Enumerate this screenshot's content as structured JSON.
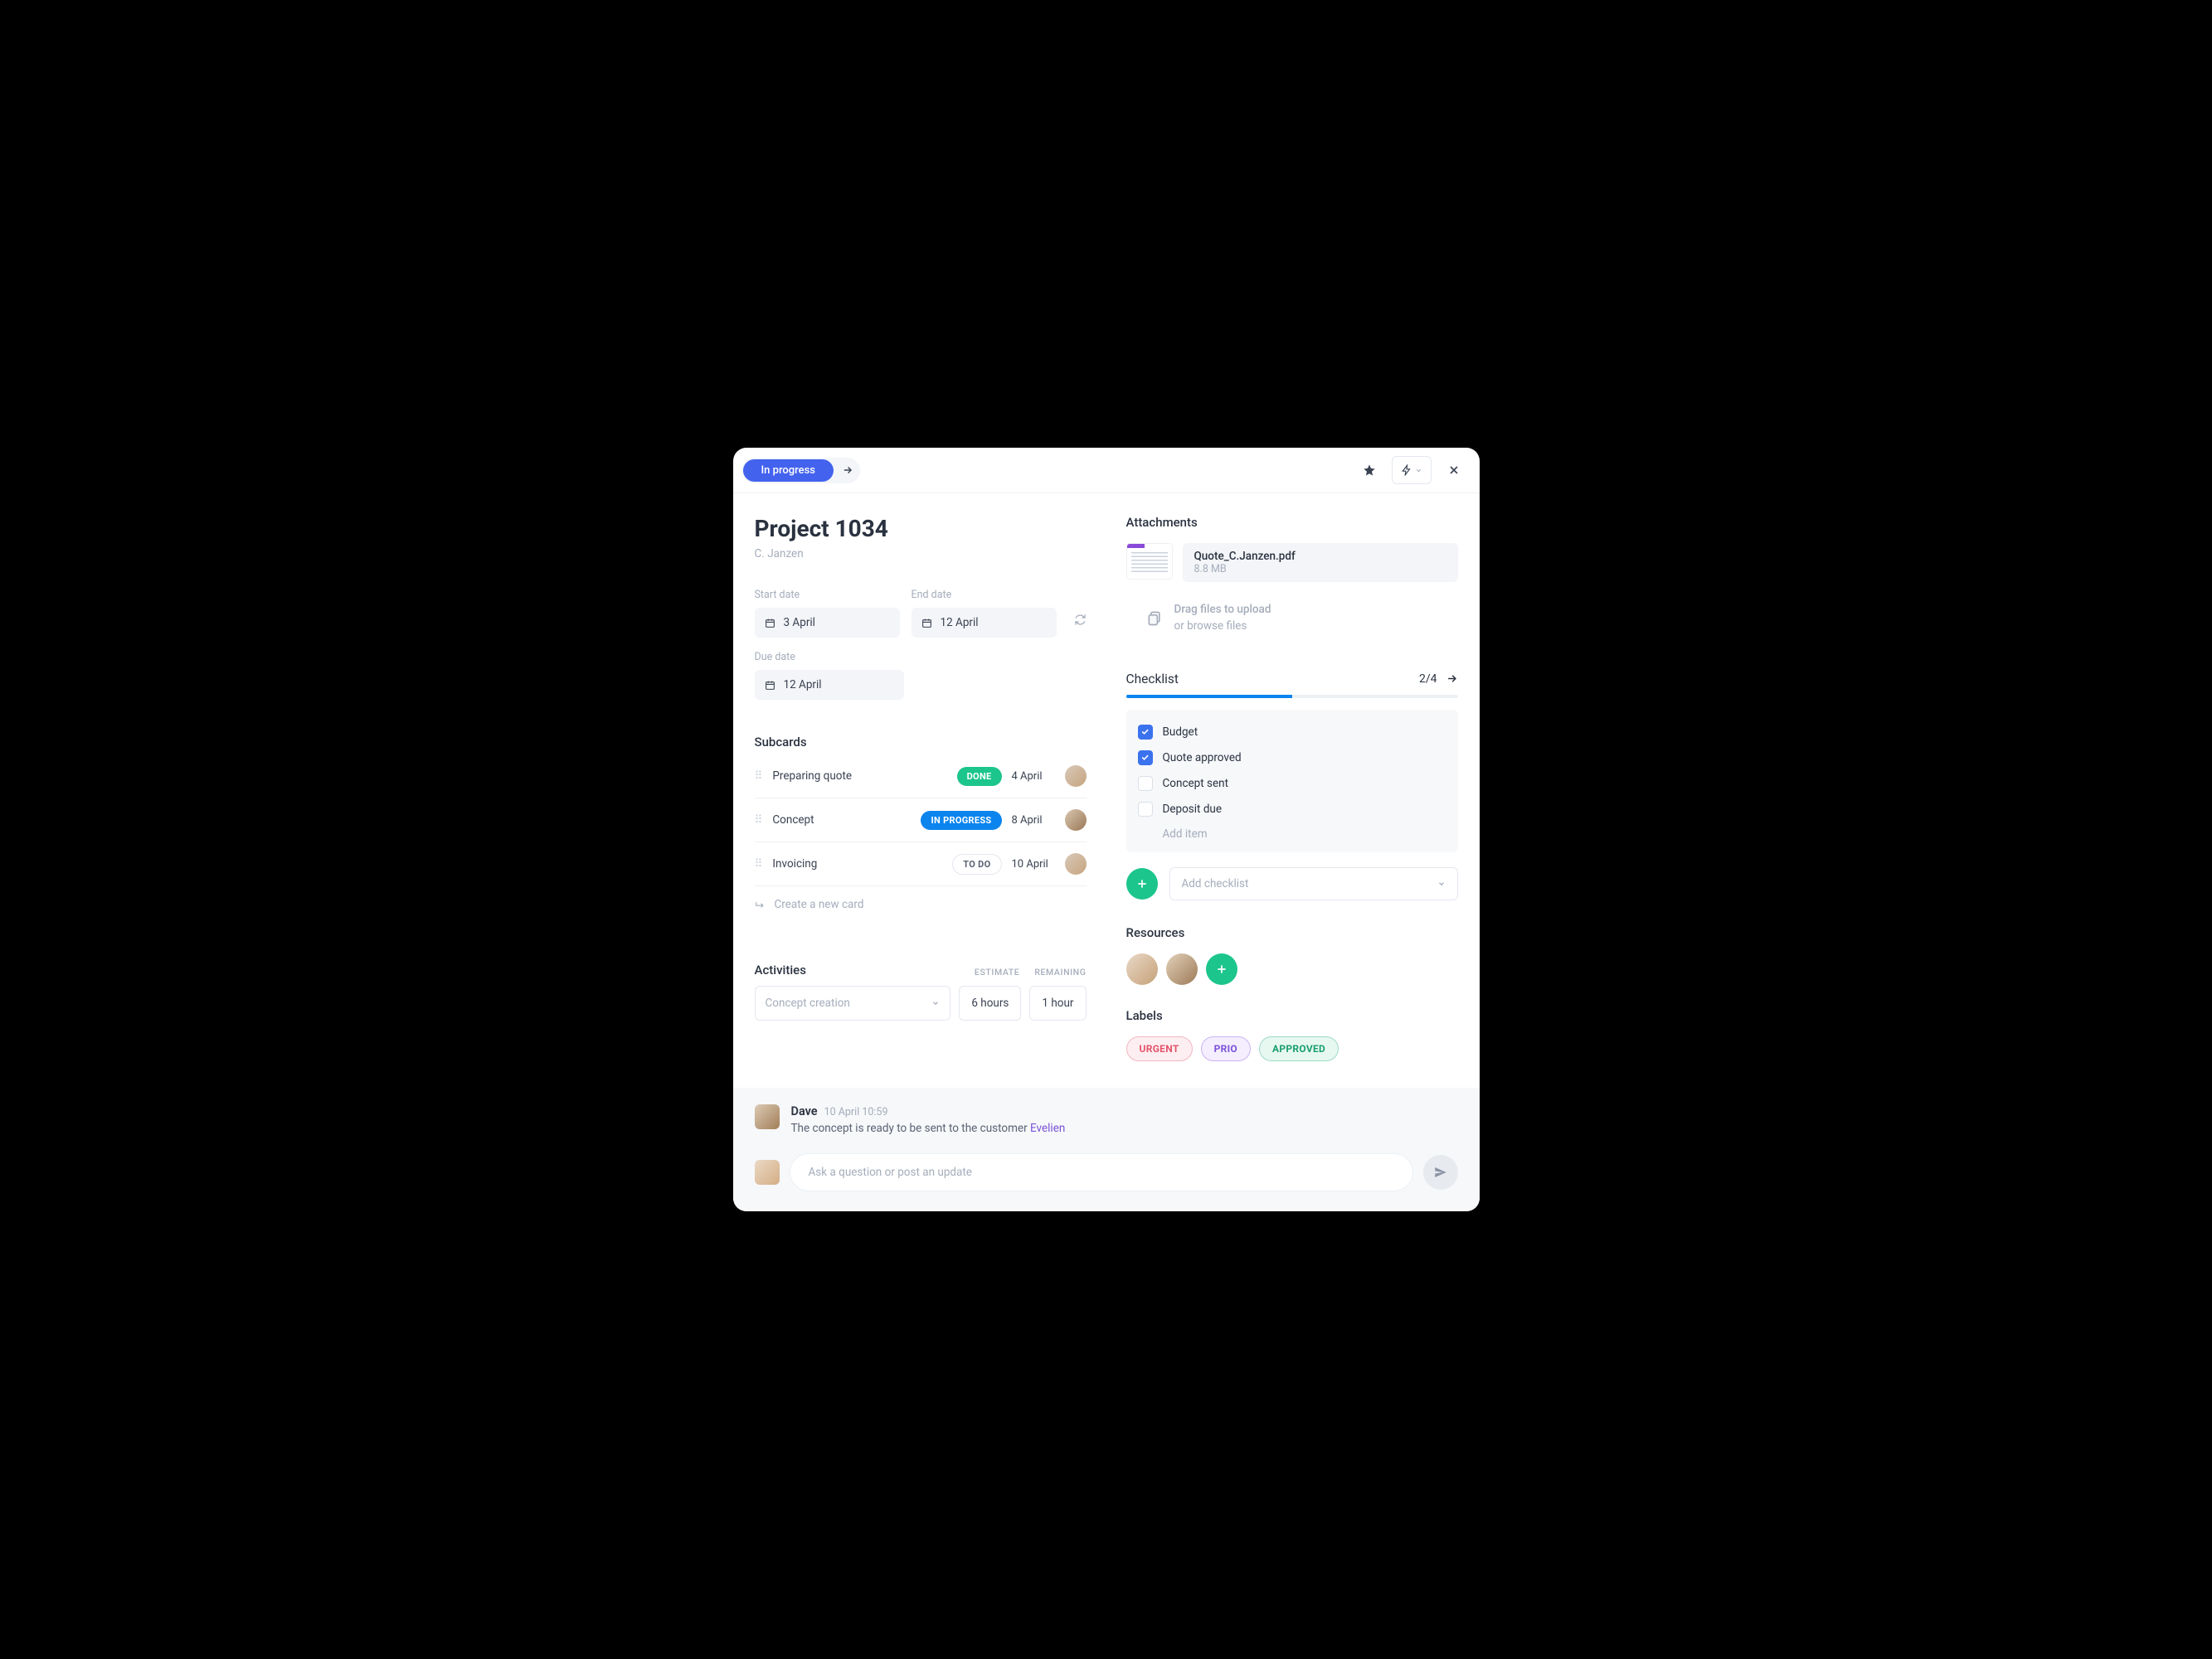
{
  "header": {
    "status_label": "In progress"
  },
  "project": {
    "title": "Project 1034",
    "owner": "C. Janzen",
    "start_date_label": "Start date",
    "start_date_value": "3 April",
    "end_date_label": "End date",
    "end_date_value": "12 April",
    "due_date_label": "Due date",
    "due_date_value": "12 April"
  },
  "subcards": {
    "title": "Subcards",
    "items": [
      {
        "name": "Preparing quote",
        "status": "DONE",
        "status_class": "done",
        "date": "4 April",
        "avatar": "f"
      },
      {
        "name": "Concept",
        "status": "IN PROGRESS",
        "status_class": "inprogress",
        "date": "8 April",
        "avatar": "m"
      },
      {
        "name": "Invoicing",
        "status": "TO DO",
        "status_class": "todo",
        "date": "10 April",
        "avatar": "f"
      }
    ],
    "create_label": "Create a new card"
  },
  "activities": {
    "title": "Activities",
    "col_estimate": "ESTIMATE",
    "col_remaining": "REMAINING",
    "select_placeholder": "Concept creation",
    "estimate_value": "6 hours",
    "remaining_value": "1 hour"
  },
  "attachments": {
    "title": "Attachments",
    "file_name": "Quote_C.Janzen.pdf",
    "file_size": "8.8 MB",
    "upload_line1": "Drag files to upload",
    "upload_line2": "or browse files"
  },
  "checklist": {
    "title": "Checklist",
    "count": "2/4",
    "progress_percent": 50,
    "items": [
      {
        "label": "Budget",
        "checked": true
      },
      {
        "label": "Quote approved",
        "checked": true
      },
      {
        "label": "Concept sent",
        "checked": false
      },
      {
        "label": "Deposit due",
        "checked": false
      }
    ],
    "add_item_placeholder": "Add item",
    "add_checklist_placeholder": "Add checklist"
  },
  "resources": {
    "title": "Resources"
  },
  "labels_section": {
    "title": "Labels",
    "tags": {
      "urgent": "URGENT",
      "prio": "PRIO",
      "approved": "APPROVED"
    }
  },
  "comments": {
    "author": "Dave",
    "timestamp": "10 April 10:59",
    "text_prefix": "The concept is ready to be sent to the customer ",
    "mention": "Evelien",
    "compose_placeholder": "Ask a question or post an update"
  }
}
